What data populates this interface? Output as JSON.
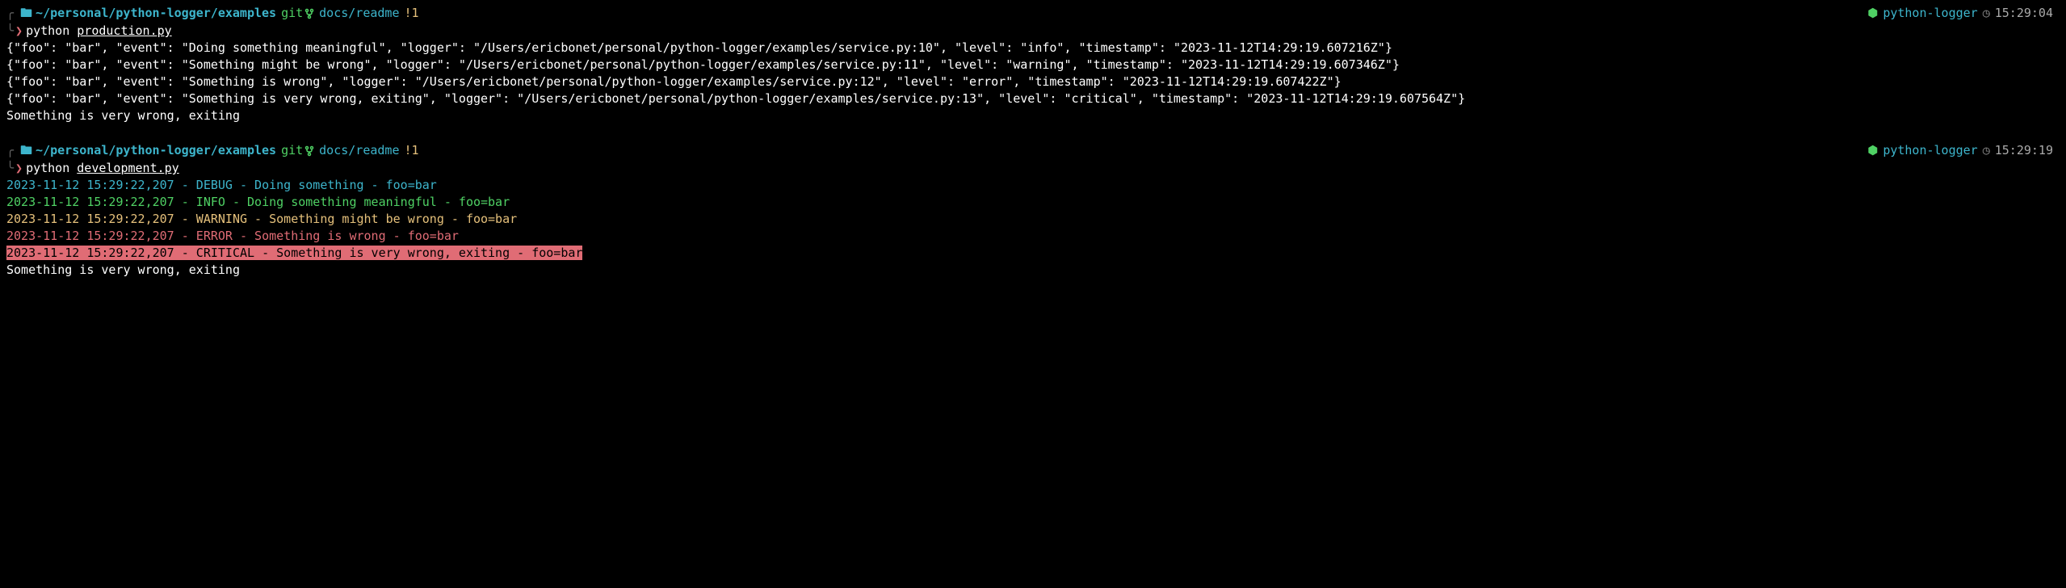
{
  "block1": {
    "prompt": {
      "path": "~/personal/python-logger/examples",
      "git_label": "git",
      "branch": "docs/readme",
      "changes": "!1",
      "project": "python-logger",
      "time": "15:29:04"
    },
    "command": {
      "cmd": "python",
      "file": "production.py"
    },
    "output_lines": [
      "{\"foo\": \"bar\", \"event\": \"Doing something meaningful\", \"logger\": \"/Users/ericbonet/personal/python-logger/examples/service.py:10\", \"level\": \"info\", \"timestamp\": \"2023-11-12T14:29:19.607216Z\"}",
      "{\"foo\": \"bar\", \"event\": \"Something might be wrong\", \"logger\": \"/Users/ericbonet/personal/python-logger/examples/service.py:11\", \"level\": \"warning\", \"timestamp\": \"2023-11-12T14:29:19.607346Z\"}",
      "{\"foo\": \"bar\", \"event\": \"Something is wrong\", \"logger\": \"/Users/ericbonet/personal/python-logger/examples/service.py:12\", \"level\": \"error\", \"timestamp\": \"2023-11-12T14:29:19.607422Z\"}",
      "{\"foo\": \"bar\", \"event\": \"Something is very wrong, exiting\", \"logger\": \"/Users/ericbonet/personal/python-logger/examples/service.py:13\", \"level\": \"critical\", \"timestamp\": \"2023-11-12T14:29:19.607564Z\"}",
      "Something is very wrong, exiting"
    ]
  },
  "block2": {
    "prompt": {
      "path": "~/personal/python-logger/examples",
      "git_label": "git",
      "branch": "docs/readme",
      "changes": "!1",
      "project": "python-logger",
      "time": "15:29:19"
    },
    "command": {
      "cmd": "python",
      "file": "development.py"
    },
    "log_lines": [
      {
        "level": "debug",
        "text": "2023-11-12 15:29:22,207 - DEBUG - Doing something - foo=bar"
      },
      {
        "level": "info",
        "text": "2023-11-12 15:29:22,207 - INFO - Doing something meaningful - foo=bar"
      },
      {
        "level": "warning",
        "text": "2023-11-12 15:29:22,207 - WARNING - Something might be wrong - foo=bar"
      },
      {
        "level": "error",
        "text": "2023-11-12 15:29:22,207 - ERROR - Something is wrong - foo=bar"
      },
      {
        "level": "critical",
        "text": "2023-11-12 15:29:22,207 - CRITICAL - Something is very wrong, exiting - foo=bar"
      }
    ],
    "final_line": "Something is very wrong, exiting"
  }
}
